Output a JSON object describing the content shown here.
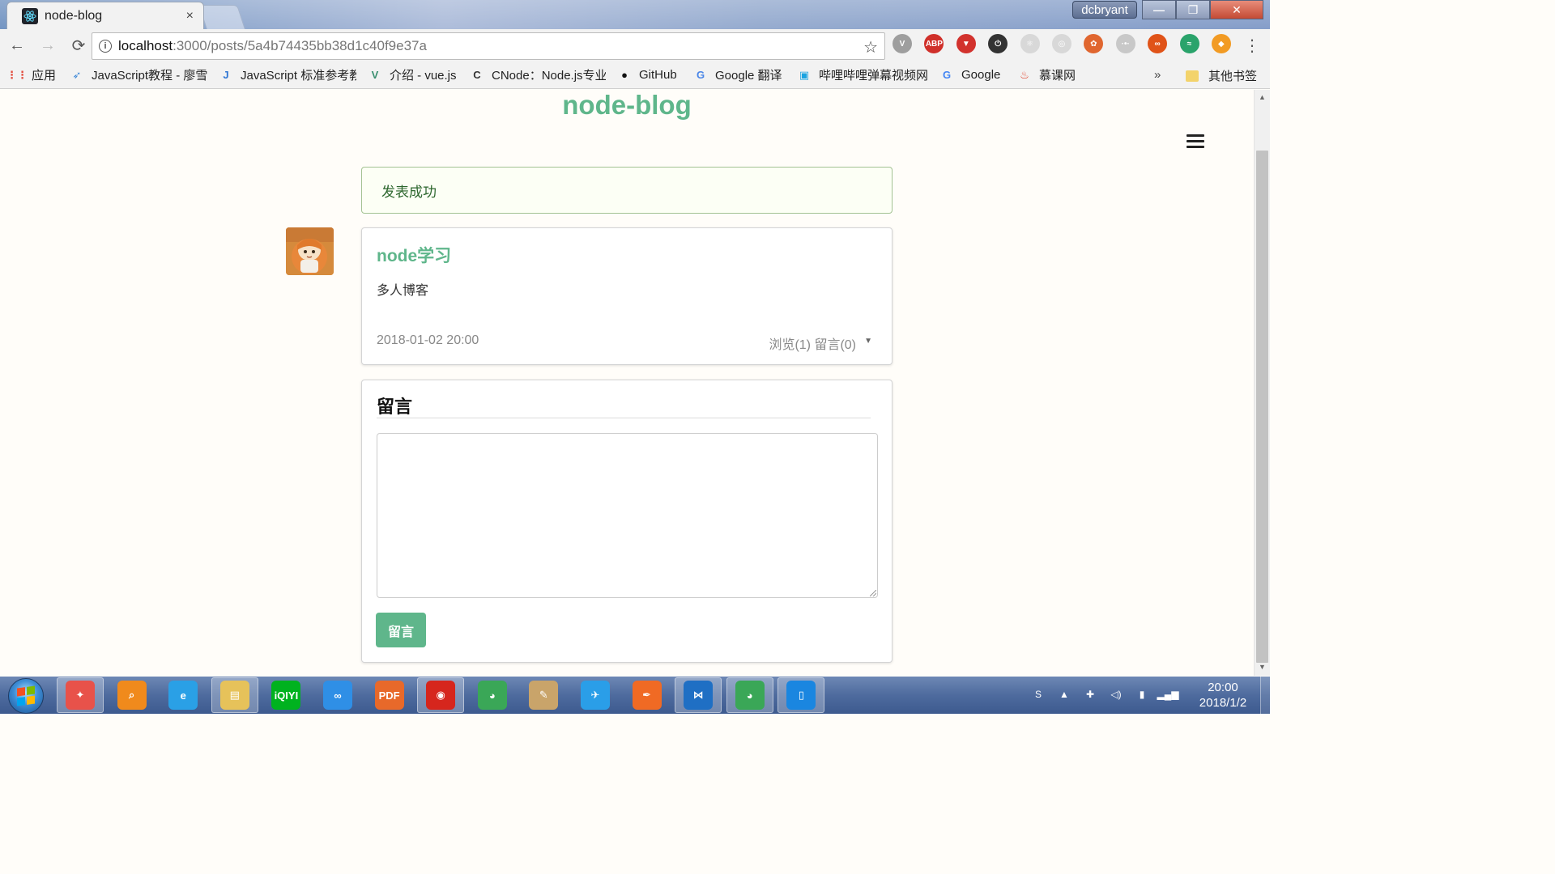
{
  "browser": {
    "tab": {
      "title": "node-blog",
      "close": "×"
    },
    "user_badge": "dcbryant",
    "window_buttons": {
      "minimize": "—",
      "restore": "❐",
      "close": "✕"
    },
    "nav": {
      "back": "←",
      "forward": "→",
      "reload": "⟳"
    },
    "address": {
      "host": "localhost",
      "path": ":3000/posts/5a4b74435bb38d1c40f9e37a",
      "info": "i"
    },
    "star": "☆",
    "menu": "⋮",
    "extensions": [
      {
        "name": "vimium-icon",
        "label": "V",
        "color": "#9e9e9e"
      },
      {
        "name": "adblock-plus-icon",
        "label": "ABP",
        "color": "#d0302a"
      },
      {
        "name": "shield-icon",
        "label": "▼",
        "color": "#d2322d"
      },
      {
        "name": "power-icon",
        "label": "⏻",
        "color": "#333333"
      },
      {
        "name": "react-devtools-icon",
        "label": "⚛",
        "color": "#d8d8d8"
      },
      {
        "name": "circle-ext-icon",
        "label": "◎",
        "color": "#d8d8d8"
      },
      {
        "name": "pinwheel-icon",
        "label": "✿",
        "color": "#e0662f"
      },
      {
        "name": "dots-ext-icon",
        "label": "·•·",
        "color": "#c8c8c8"
      },
      {
        "name": "infinity-icon",
        "label": "∞",
        "color": "#e05318"
      },
      {
        "name": "swift-ext-icon",
        "label": "≈",
        "color": "#2aa36b"
      },
      {
        "name": "fish-ext-icon",
        "label": "◆",
        "color": "#f29b24"
      }
    ],
    "bookmarks": [
      {
        "name": "bookmark-apps",
        "icon": "apps-grid-icon",
        "icon_text": "⋮⋮",
        "icon_color": "#e24a3b",
        "label": "应用",
        "width": 60
      },
      {
        "name": "bookmark-js-tutorial",
        "icon": "rocket-icon",
        "icon_text": "➶",
        "icon_color": "#3b87d8",
        "label": "JavaScript教程 - 廖雪",
        "width": 170
      },
      {
        "name": "bookmark-js-reference",
        "icon": "j-icon",
        "icon_text": "J",
        "icon_color": "#2f76d4",
        "label": "JavaScript 标准参考教",
        "width": 170
      },
      {
        "name": "bookmark-vue",
        "icon": "vue-icon",
        "icon_text": "V",
        "icon_color": "#3a8f6f",
        "label": "介绍 - vue.js",
        "width": 112
      },
      {
        "name": "bookmark-cnode",
        "icon": "cnode-icon",
        "icon_text": "C",
        "icon_color": "#333333",
        "label": "CNode：Node.js专业",
        "width": 168
      },
      {
        "name": "bookmark-github",
        "icon": "github-icon",
        "icon_text": "●",
        "icon_color": "#111111",
        "label": "GitHub",
        "width": 80
      },
      {
        "name": "bookmark-google-translate",
        "icon": "translate-icon",
        "icon_text": "G",
        "icon_color": "#4a86e8",
        "label": "Google 翻译",
        "width": 114
      },
      {
        "name": "bookmark-bilibili",
        "icon": "bilibili-icon",
        "icon_text": "▣",
        "icon_color": "#1aa3e0",
        "label": "哔哩哔哩弹幕视频网",
        "width": 162
      },
      {
        "name": "bookmark-google",
        "icon": "google-icon",
        "icon_text": "G",
        "icon_color": "#4285f4",
        "label": "Google",
        "width": 82
      },
      {
        "name": "bookmark-imooc",
        "icon": "flame-icon",
        "icon_text": "♨",
        "icon_color": "#e0402a",
        "label": "慕课网",
        "width": 74
      }
    ],
    "bookmarks_more": "»",
    "other_bookmarks": "其他书签"
  },
  "page": {
    "site_title": "node-blog",
    "alert": "发表成功",
    "post": {
      "title": "node学习",
      "content": "多人博客",
      "date": "2018-01-02 20:00",
      "stats": "浏览(1) 留言(0)",
      "caret": "▼"
    },
    "comments": {
      "heading": "留言",
      "textarea_value": "",
      "submit_label": "留言"
    }
  },
  "scrollbar": {
    "up": "▲",
    "down": "▼"
  },
  "taskbar": {
    "apps": [
      {
        "name": "taskbar-pinwheel-app",
        "icon": "pinwheel-app-icon",
        "label": "✦",
        "color": "#e8524a",
        "active": true
      },
      {
        "name": "taskbar-search-app",
        "icon": "magnifier-icon",
        "label": "⌕",
        "color": "#f08a1c",
        "active": false
      },
      {
        "name": "taskbar-ie",
        "icon": "internet-explorer-icon",
        "label": "e",
        "color": "#2aa0e6",
        "active": false
      },
      {
        "name": "taskbar-explorer",
        "icon": "folder-icon",
        "label": "▤",
        "color": "#e6c25a",
        "active": true
      },
      {
        "name": "taskbar-iqiyi",
        "icon": "iqiyi-icon",
        "label": "iQIYI",
        "color": "#00b21f",
        "active": false
      },
      {
        "name": "taskbar-baidu-cloud",
        "icon": "cloud-icon",
        "label": "∞",
        "color": "#2f8fe6",
        "active": false
      },
      {
        "name": "taskbar-pdf",
        "icon": "pdf-icon",
        "label": "PDF",
        "color": "#e8692a",
        "active": false
      },
      {
        "name": "taskbar-netease-music",
        "icon": "music-icon",
        "label": "◉",
        "color": "#d6261d",
        "active": true
      },
      {
        "name": "taskbar-chrome",
        "icon": "chrome-icon",
        "label": "◕",
        "color": "#3aa757",
        "active": false
      },
      {
        "name": "taskbar-paint",
        "icon": "palette-icon",
        "label": "✎",
        "color": "#c9a46a",
        "active": false
      },
      {
        "name": "taskbar-bird-app",
        "icon": "bird-icon",
        "label": "✈",
        "color": "#2a9ee8",
        "active": false
      },
      {
        "name": "taskbar-feather-app",
        "icon": "feather-icon",
        "label": "✒",
        "color": "#f06a24",
        "active": false
      },
      {
        "name": "taskbar-vscode",
        "icon": "vscode-icon",
        "label": "⋈",
        "color": "#1f6fc4",
        "active": true
      },
      {
        "name": "taskbar-chrome-active",
        "icon": "chrome-icon",
        "label": "◕",
        "color": "#3aa757",
        "active": true
      },
      {
        "name": "taskbar-phone-app",
        "icon": "phone-icon",
        "label": "▯",
        "color": "#1a86e0",
        "active": true
      }
    ],
    "tray": [
      {
        "name": "sogou-input-icon",
        "label": "S"
      },
      {
        "name": "tray-expand-icon",
        "label": "▲"
      },
      {
        "name": "network-status-icon",
        "label": "✚"
      },
      {
        "name": "volume-icon",
        "label": "◁)"
      },
      {
        "name": "battery-icon",
        "label": "▮"
      },
      {
        "name": "signal-icon",
        "label": "▂▄▆"
      }
    ],
    "clock": {
      "time": "20:00",
      "date": "2018/1/2"
    }
  }
}
